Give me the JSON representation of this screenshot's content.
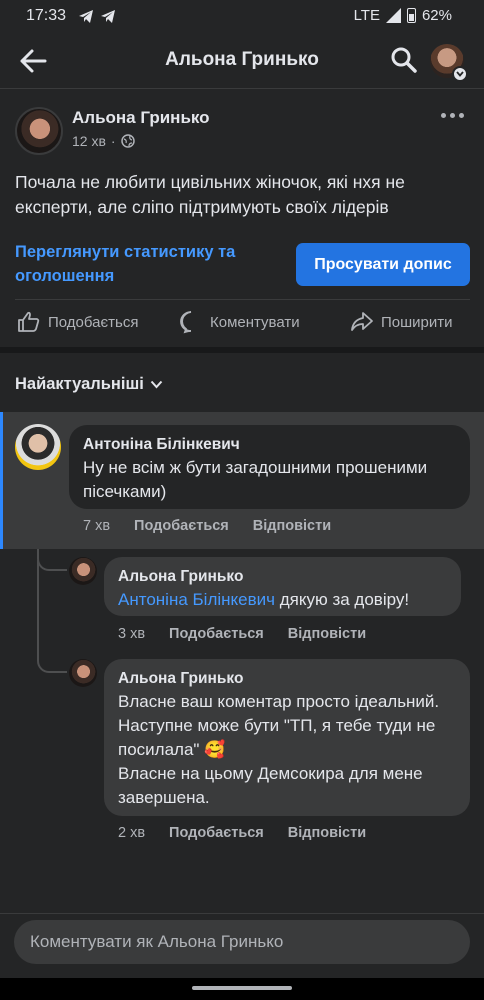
{
  "status_bar": {
    "time": "17:33",
    "network": "LTE",
    "battery": "62%",
    "icons": [
      "telegram-icon",
      "telegram-icon",
      "signal-icon",
      "battery-icon"
    ]
  },
  "header": {
    "title": "Альона Гринько",
    "icons": [
      "back-arrow-icon",
      "search-icon",
      "profile-switch-icon"
    ]
  },
  "post": {
    "author": "Альона Гринько",
    "time": "12 хв",
    "audience_icon": "globe-icon",
    "text": "Почала не любити цивільних жіночок, які нхя не експерти, але сліпо підтримують своїх лідерів",
    "stats_link": "Переглянути статистику та оголошення",
    "boost_button": "Просувати допис",
    "actions": {
      "like": "Подобається",
      "comment": "Коментувати",
      "share": "Поширити"
    }
  },
  "comments": {
    "sort_label": "Найактуальніші",
    "items": [
      {
        "author": "Антоніна Білінкевич",
        "text": "Ну не всім ж бути загадошними прошеними пісечками)",
        "time": "7 хв",
        "like": "Подобається",
        "reply": "Відповісти",
        "highlighted": true
      },
      {
        "author": "Альона Гринько",
        "mention": "Антоніна Білінкевич",
        "text": " дякую за довіру!",
        "time": "3 хв",
        "like": "Подобається",
        "reply": "Відповісти"
      },
      {
        "author": "Альона Гринько",
        "text": "Власне ваш коментар просто ідеальний. Наступне може бути \"ТП, я тебе туди не посилала\" 🥰\nВласне на цьому Демсокира для мене завершена.",
        "time": "2 хв",
        "like": "Подобається",
        "reply": "Відповісти"
      }
    ]
  },
  "composer": {
    "placeholder": "Коментувати як Альона Гринько"
  },
  "colors": {
    "background": "#242526",
    "accent": "#2374e1",
    "link": "#4599ff",
    "text": "#e4e6eb",
    "muted": "#b0b3b8"
  }
}
